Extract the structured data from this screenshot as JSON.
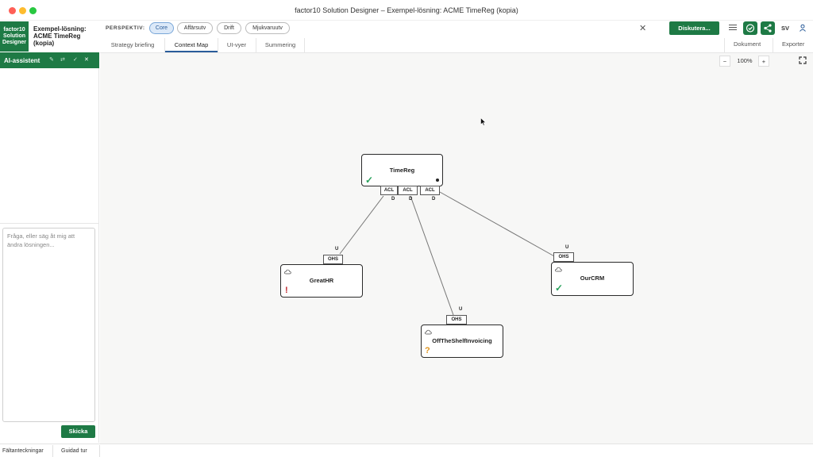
{
  "window": {
    "title": "factor10 Solution Designer – Exempel-lösning: ACME TimeReg (kopia)"
  },
  "brand": {
    "line1": "factor10",
    "line2": "Solution",
    "line3": "Designer"
  },
  "solution": {
    "line1": "Exempel-lösning:",
    "line2": "ACME TimeReg",
    "line3": "(kopia)"
  },
  "header": {
    "perspective_label": "PERSPEKTIV:",
    "perspectives": [
      "Core",
      "Affärsutv",
      "Drift",
      "Mjukvaruutv"
    ],
    "active_perspective": "Core",
    "discuss_button": "Diskutera...",
    "language": "SV",
    "tabs": [
      "Strategy briefing",
      "Context Map",
      "UI-vyer",
      "Summering"
    ],
    "active_tab": "Context Map",
    "right_tabs": [
      "Dokument",
      "Exporter"
    ]
  },
  "ai": {
    "title": "AI-assistent",
    "placeholder": "Fråga, eller säg åt mig att ändra lösningen...",
    "send": "Skicka"
  },
  "statusbar": {
    "items": [
      "Fältanteckningar",
      "Guidad tur"
    ]
  },
  "zoom": {
    "minus": "−",
    "level": "100%",
    "plus": "+"
  },
  "context_map": {
    "contexts": [
      {
        "name": "TimeReg",
        "status": "✓",
        "status_color": "#27a05a"
      },
      {
        "name": "GreatHR",
        "status": "!",
        "status_color": "#c0262d"
      },
      {
        "name": "OurCRM",
        "status": "✓",
        "status_color": "#27a05a"
      },
      {
        "name": "OffTheShelfInvoicing",
        "status": "?",
        "status_color": "#e0951f"
      }
    ],
    "relations": [
      {
        "upstream_pattern": "OHS",
        "upstream_label": "U",
        "downstream_pattern": "ACL",
        "downstream_label": "D"
      },
      {
        "upstream_pattern": "OHS",
        "upstream_label": "U",
        "downstream_pattern": "ACL",
        "downstream_label": "D"
      },
      {
        "upstream_pattern": "OHS",
        "upstream_label": "U",
        "downstream_pattern": "ACL",
        "downstream_label": "D"
      }
    ]
  },
  "colors": {
    "accent": "#1e7a45",
    "active_tab": "#2a5c9a"
  }
}
